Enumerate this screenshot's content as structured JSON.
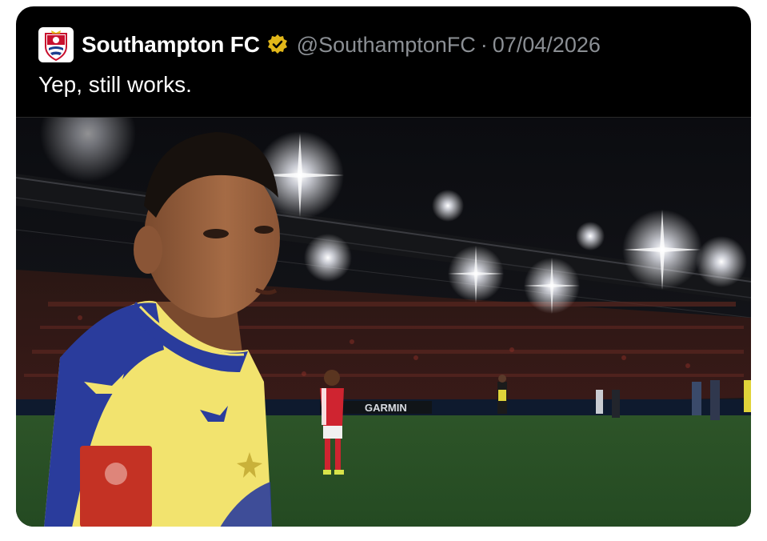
{
  "tweet": {
    "author_name": "Southampton FC",
    "handle": "@SouthamptonFC",
    "separator": "·",
    "date": "07/04/2026",
    "text": "Yep, still works."
  },
  "media": {
    "board_text": "GARMIN",
    "description_icon": "photo-media"
  },
  "colors": {
    "background": "#000000",
    "name": "#ffffff",
    "meta": "#8b8f94",
    "verified_badge": "#e2b719",
    "kit_yellow": "#f2e36e",
    "kit_blue": "#2a3c9c",
    "opponent_red": "#cf2430",
    "pitch": "#2f5a2a"
  }
}
